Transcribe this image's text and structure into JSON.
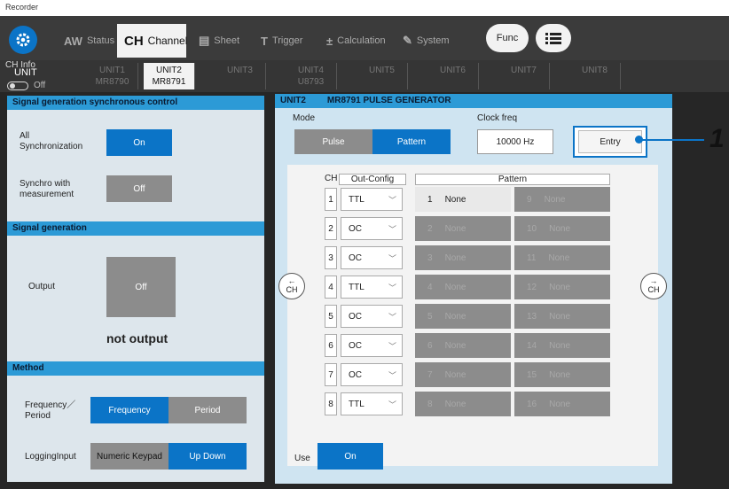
{
  "window": {
    "title": "Recorder"
  },
  "tabs": [
    {
      "icon": "AW",
      "label": "Status"
    },
    {
      "icon": "CH",
      "label": "Channel"
    },
    {
      "icon": "▤",
      "label": "Sheet"
    },
    {
      "icon": "T",
      "label": "Trigger"
    },
    {
      "icon": "±",
      "label": "Calculation"
    },
    {
      "icon": "✎",
      "label": "System"
    }
  ],
  "func_label": "Func",
  "units": [
    {
      "name": "UNIT1",
      "model": "MR8790"
    },
    {
      "name": "UNIT2",
      "model": "MR8791"
    },
    {
      "name": "UNIT3",
      "model": ""
    },
    {
      "name": "UNIT4",
      "model": "U8793"
    },
    {
      "name": "UNIT5",
      "model": ""
    },
    {
      "name": "UNIT6",
      "model": ""
    },
    {
      "name": "UNIT7",
      "model": ""
    },
    {
      "name": "UNIT8",
      "model": ""
    }
  ],
  "chinfo": {
    "label": "CH Info",
    "unit": "UNIT",
    "toggle": "Off"
  },
  "left": {
    "sync_header": "Signal generation synchronous control",
    "all_sync_label": "All\nSynchronization",
    "all_sync_value": "On",
    "sync_meas_label": "Synchro with\nmeasurement",
    "sync_meas_value": "Off",
    "gen_header": "Signal generation",
    "output_label": "Output",
    "output_value": "Off",
    "output_status": "not output",
    "method_header": "Method",
    "freq_label": "Frequency／\nPeriod",
    "freq_option": "Frequency",
    "period_option": "Period",
    "logging_label": "LoggingInput",
    "numeric_option": "Numeric Keypad",
    "updown_option": "Up Down"
  },
  "right": {
    "header_unit": "UNIT2",
    "header_title": "MR8791 PULSE GENERATOR",
    "mode_label": "Mode",
    "mode_pulse": "Pulse",
    "mode_pattern": "Pattern",
    "clock_label": "Clock freq",
    "clock_value": "10000 Hz",
    "entry_label": "Entry",
    "col_ch": "CH",
    "col_out": "Out-Config",
    "col_pattern": "Pattern",
    "nav_left_label": "CH",
    "nav_right_label": "CH",
    "use_label": "Use",
    "use_value": "On",
    "rows": [
      {
        "ch": "1",
        "out": "TTL",
        "p1n": "1",
        "p1": "None",
        "p2n": "9",
        "p2": "None"
      },
      {
        "ch": "2",
        "out": "OC",
        "p1n": "2",
        "p1": "None",
        "p2n": "10",
        "p2": "None"
      },
      {
        "ch": "3",
        "out": "OC",
        "p1n": "3",
        "p1": "None",
        "p2n": "11",
        "p2": "None"
      },
      {
        "ch": "4",
        "out": "TTL",
        "p1n": "4",
        "p1": "None",
        "p2n": "12",
        "p2": "None"
      },
      {
        "ch": "5",
        "out": "OC",
        "p1n": "5",
        "p1": "None",
        "p2n": "13",
        "p2": "None"
      },
      {
        "ch": "6",
        "out": "OC",
        "p1n": "6",
        "p1": "None",
        "p2n": "14",
        "p2": "None"
      },
      {
        "ch": "7",
        "out": "OC",
        "p1n": "7",
        "p1": "None",
        "p2n": "15",
        "p2": "None"
      },
      {
        "ch": "8",
        "out": "TTL",
        "p1n": "8",
        "p1": "None",
        "p2n": "16",
        "p2": "None"
      }
    ]
  },
  "callout": "1",
  "colors": {
    "accent": "#0b74c7",
    "header": "#2c9ad6",
    "panel": "#dde6ec",
    "off": "#8c8c8c"
  }
}
